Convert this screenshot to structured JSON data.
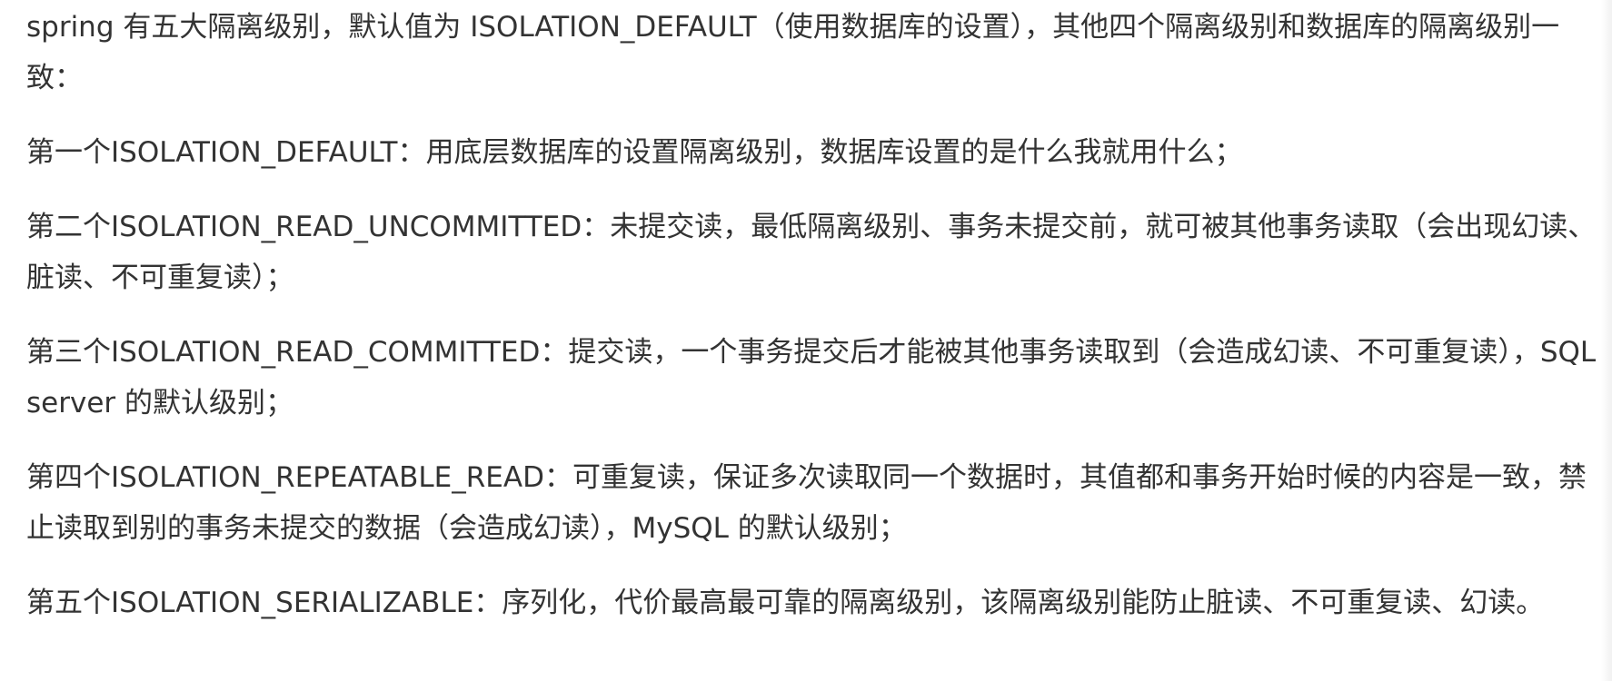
{
  "paragraphs": [
    "spring 有五大隔离级别，默认值为 ISOLATION_DEFAULT（使用数据库的设置），其他四个隔离级别和数据库的隔离级别一致：",
    "第一个ISOLATION_DEFAULT：用底层数据库的设置隔离级别，数据库设置的是什么我就用什么；",
    "第二个ISOLATION_READ_UNCOMMITTED：未提交读，最低隔离级别、事务未提交前，就可被其他事务读取（会出现幻读、脏读、不可重复读）；",
    "第三个ISOLATION_READ_COMMITTED：提交读，一个事务提交后才能被其他事务读取到（会造成幻读、不可重复读），SQL server 的默认级别；",
    "第四个ISOLATION_REPEATABLE_READ：可重复读，保证多次读取同一个数据时，其值都和事务开始时候的内容是一致，禁止读取到别的事务未提交的数据（会造成幻读），MySQL 的默认级别；",
    "第五个ISOLATION_SERIALIZABLE：序列化，代价最高最可靠的隔离级别，该隔离级别能防止脏读、不可重复读、幻读。"
  ]
}
